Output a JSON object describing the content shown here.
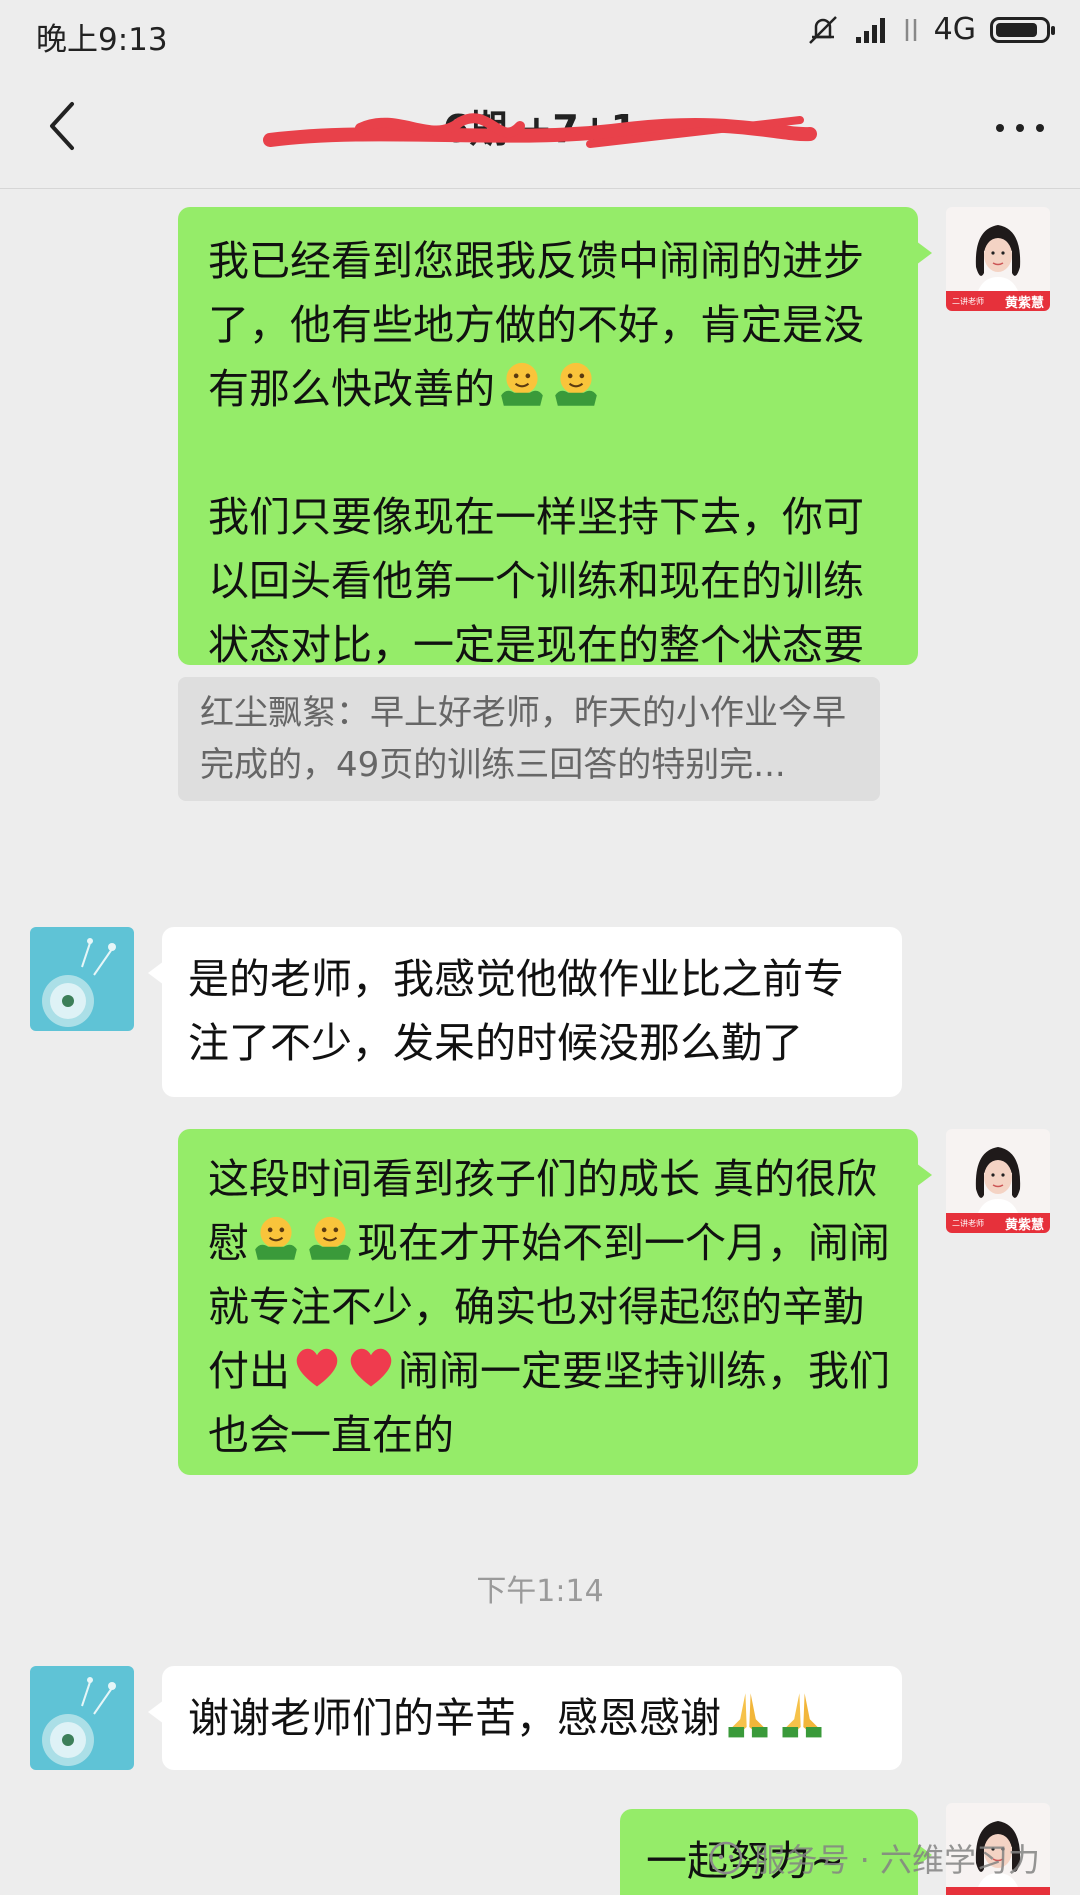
{
  "status_bar": {
    "time": "晚上9:13",
    "network": "4G",
    "battery_level": 0.85
  },
  "header": {
    "title": "6期 +7+1",
    "back_icon": "chevron-left-icon",
    "more_icon": "more-dots-icon"
  },
  "teacher": {
    "name": "黄紫慧",
    "tag": "二讲老师"
  },
  "messages": {
    "m1": {
      "p1": "我已经看到您跟我反馈中闹闹的进步了，他有些地方做的不好，肯定是没有那么快改善的",
      "emoji": "hugging-face-emoji",
      "p2": "我们只要像现在一样坚持下去，你可以回头看他第一个训练和现在的训练状态对比，一定是现在的整个状态要好的"
    },
    "quote": "红尘飘絮：早上好老师，昨天的小作业今早完成的，49页的训练三回答的特别完...",
    "m2": {
      "text": "是的老师，我感觉他做作业比之前专注了不少，发呆的时候没那么勤了"
    },
    "m3": {
      "a": "这段时间看到孩子们的成长  真的很欣慰",
      "b": "现在才开始不到一个月，闹闹就专注不少，确实也对得起您的辛勤付出",
      "c": "闹闹一定要坚持训练，我们也会一直在的",
      "emoji1": "hugging-face-emoji",
      "emoji2": "red-heart-emoji"
    },
    "timestamp": "下午1:14",
    "m4": {
      "text": "谢谢老师们的辛苦，感恩感谢",
      "emoji": "folded-hands-emoji"
    },
    "m5": {
      "text": "一起努力~"
    }
  },
  "watermark": {
    "text": "服务号 · 六维学习力"
  },
  "colors": {
    "outgoing_bubble": "#95ec69",
    "incoming_bubble": "#ffffff",
    "background": "#ededed",
    "redaction": "#e8414a"
  }
}
